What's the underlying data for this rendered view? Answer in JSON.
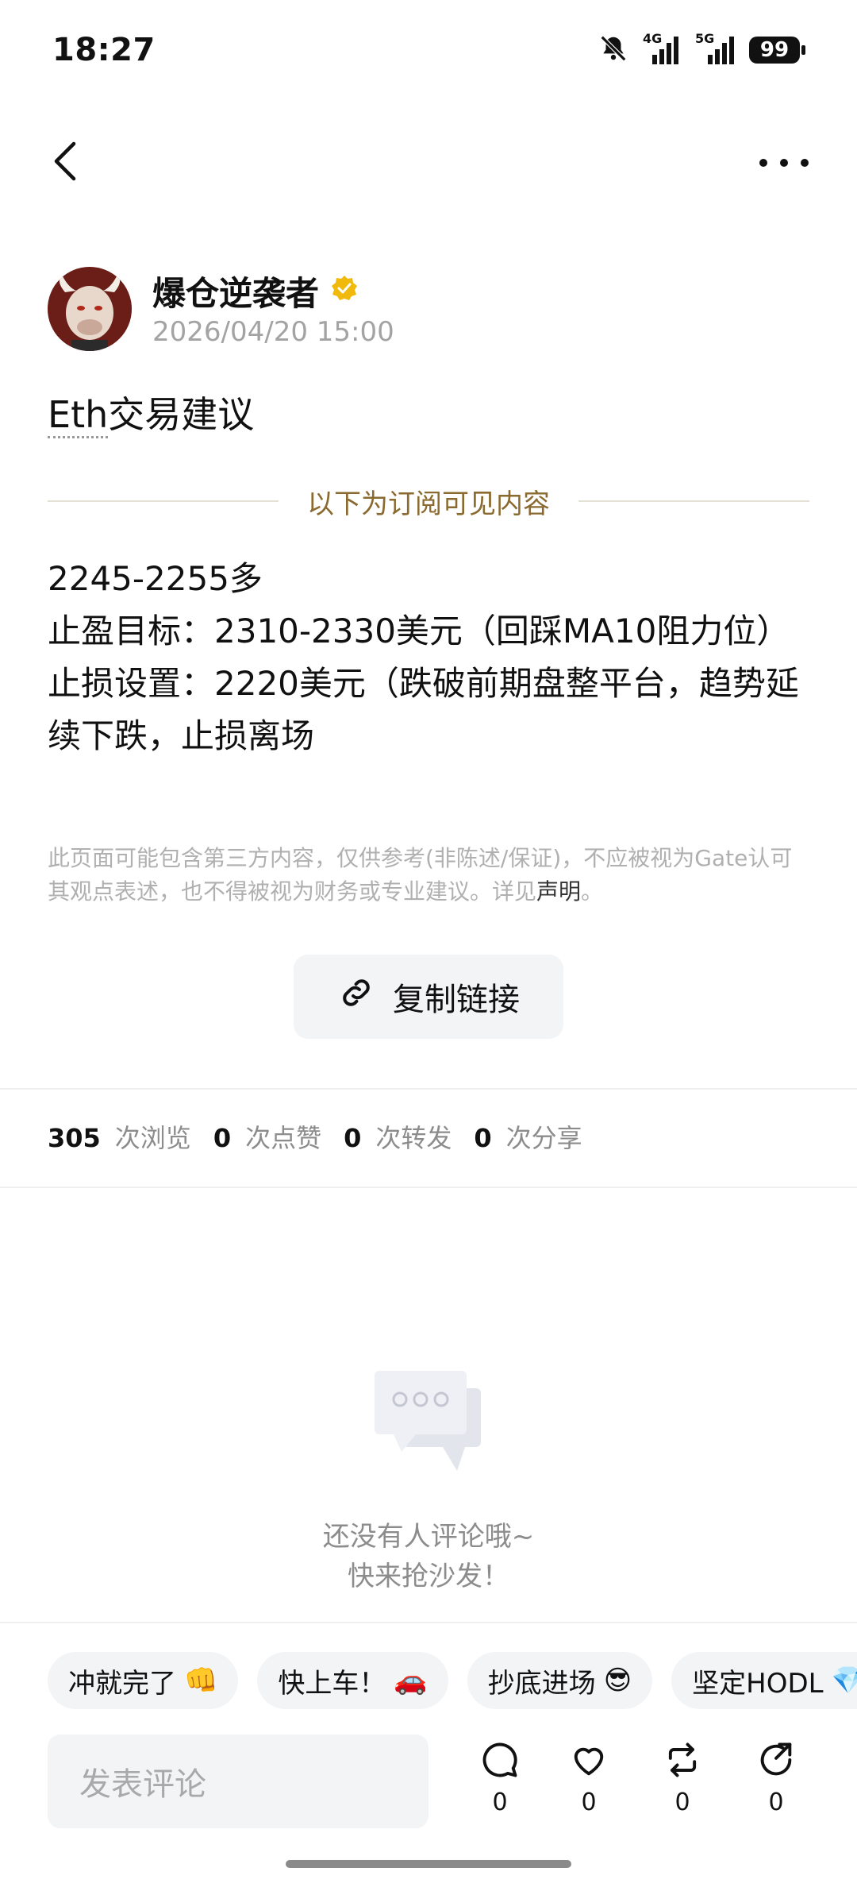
{
  "status_bar": {
    "time": "18:27",
    "network_4g": "4G",
    "network_5g": "5G",
    "battery": "99",
    "icons": [
      "mute-bell-icon",
      "signal-4g-icon",
      "signal-5g-icon",
      "battery-icon"
    ]
  },
  "nav": {
    "back_icon": "chevron-left-icon",
    "more_icon": "more-dots-icon"
  },
  "author": {
    "name": "爆仓逆袭者",
    "date": "2026/04/20 15:00",
    "verified_icon": "verified-badge-icon"
  },
  "post": {
    "title_underlined": "Eth",
    "title_rest": "交易建议",
    "subscription_label": "以下为订阅可见内容",
    "lines": [
      "2245-2255多",
      "止盈目标：2310-2330美元（回踩MA10阻力位）",
      "止损设置：2220美元（跌破前期盘整平台，趋势延续下跌，止损离场"
    ],
    "disclaimer": "此页面可能包含第三方内容，仅供参考(非陈述/保证)，不应被视为Gate认可其观点表述，也不得被视为财务或专业建议。详见",
    "disclaimer_link": "声明",
    "disclaimer_end": "。"
  },
  "copy_link": {
    "label": "复制链接",
    "icon": "link-icon"
  },
  "stats": {
    "views": "305",
    "views_label": "次浏览",
    "likes": "0",
    "likes_label": "次点赞",
    "reposts": "0",
    "reposts_label": "次转发",
    "shares": "0",
    "shares_label": "次分享"
  },
  "comments": {
    "empty_line1": "还没有人评论哦~",
    "empty_line2": "快来抢沙发！",
    "empty_icon": "chat-bubbles-icon"
  },
  "quick_replies": [
    {
      "text": "冲就完了",
      "emoji": "👊"
    },
    {
      "text": "快上车！",
      "emoji": "🚗"
    },
    {
      "text": "抄底进场",
      "emoji": "😎"
    },
    {
      "text": "坚定HODL",
      "emoji": "💎"
    }
  ],
  "bottom_bar": {
    "input_placeholder": "发表评论",
    "comment_count": "0",
    "like_count": "0",
    "repost_count": "0",
    "share_count": "0"
  },
  "colors": {
    "accent_gold": "#8a6a2e",
    "verified_yellow": "#f0b90b",
    "muted_text": "#a3a3a3",
    "chip_bg": "#f3f4f6"
  }
}
